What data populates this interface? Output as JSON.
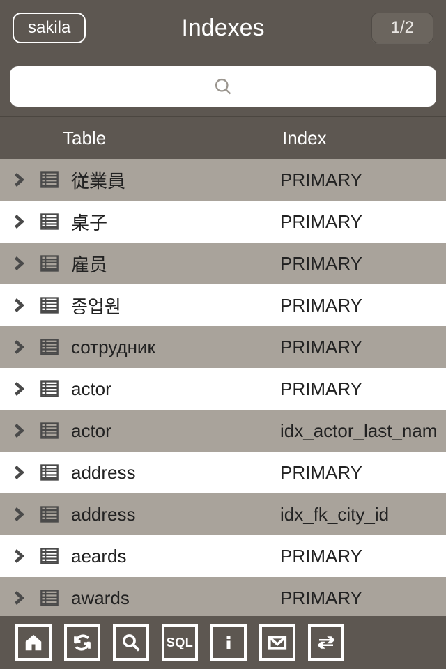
{
  "header": {
    "db_label": "sakila",
    "title": "Indexes",
    "page_label": "1/2"
  },
  "search": {
    "value": "",
    "placeholder": ""
  },
  "columns": {
    "table": "Table",
    "index": "Index"
  },
  "rows": [
    {
      "table": "従業員",
      "index": "PRIMARY"
    },
    {
      "table": "桌子",
      "index": "PRIMARY"
    },
    {
      "table": "雇员",
      "index": "PRIMARY"
    },
    {
      "table": "종업원",
      "index": "PRIMARY"
    },
    {
      "table": "сотрудник",
      "index": "PRIMARY"
    },
    {
      "table": "actor",
      "index": "PRIMARY"
    },
    {
      "table": "actor",
      "index": "idx_actor_last_nam"
    },
    {
      "table": "address",
      "index": "PRIMARY"
    },
    {
      "table": "address",
      "index": "idx_fk_city_id"
    },
    {
      "table": "aeards",
      "index": "PRIMARY"
    },
    {
      "table": "awards",
      "index": "PRIMARY"
    }
  ],
  "icons": {
    "search": "search-icon",
    "chevron": "chevron-right-icon",
    "table": "table-icon",
    "home": "home-icon",
    "refresh": "refresh-icon",
    "find": "find-icon",
    "sql": "sql-icon",
    "info": "info-icon",
    "mail": "mail-icon",
    "swap": "swap-icon"
  }
}
